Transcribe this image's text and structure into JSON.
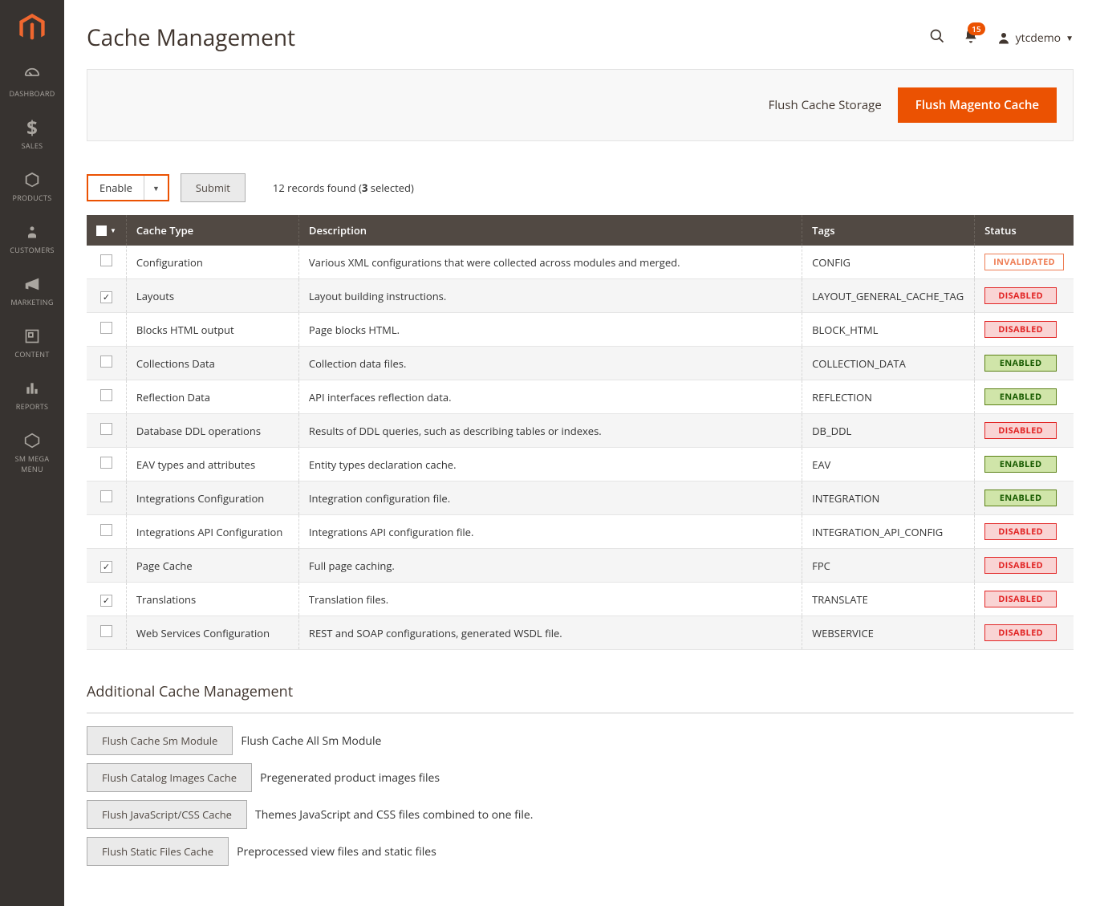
{
  "page_title": "Cache Management",
  "user": {
    "name": "ytcdemo",
    "notifications": "15"
  },
  "sidebar": [
    {
      "key": "dashboard",
      "label": "DASHBOARD"
    },
    {
      "key": "sales",
      "label": "SALES"
    },
    {
      "key": "products",
      "label": "PRODUCTS"
    },
    {
      "key": "customers",
      "label": "CUSTOMERS"
    },
    {
      "key": "marketing",
      "label": "MARKETING"
    },
    {
      "key": "content",
      "label": "CONTENT"
    },
    {
      "key": "reports",
      "label": "REPORTS"
    },
    {
      "key": "smmegamenu",
      "label": "SM MEGA\nMENU"
    }
  ],
  "titlebar": {
    "storage_link": "Flush Cache Storage",
    "flush_btn": "Flush Magento Cache"
  },
  "toolbar": {
    "action": "Enable",
    "submit": "Submit",
    "records_prefix": "12 records found (",
    "records_count": "3",
    "records_suffix": " selected)"
  },
  "headers": {
    "type": "Cache Type",
    "desc": "Description",
    "tags": "Tags",
    "status": "Status"
  },
  "rows": [
    {
      "checked": false,
      "type": "Configuration",
      "desc": "Various XML configurations that were collected across modules and merged.",
      "tags": "CONFIG",
      "status": "INVALIDATED"
    },
    {
      "checked": true,
      "type": "Layouts",
      "desc": "Layout building instructions.",
      "tags": "LAYOUT_GENERAL_CACHE_TAG",
      "status": "DISABLED"
    },
    {
      "checked": false,
      "type": "Blocks HTML output",
      "desc": "Page blocks HTML.",
      "tags": "BLOCK_HTML",
      "status": "DISABLED"
    },
    {
      "checked": false,
      "type": "Collections Data",
      "desc": "Collection data files.",
      "tags": "COLLECTION_DATA",
      "status": "ENABLED"
    },
    {
      "checked": false,
      "type": "Reflection Data",
      "desc": "API interfaces reflection data.",
      "tags": "REFLECTION",
      "status": "ENABLED"
    },
    {
      "checked": false,
      "type": "Database DDL operations",
      "desc": "Results of DDL queries, such as describing tables or indexes.",
      "tags": "DB_DDL",
      "status": "DISABLED"
    },
    {
      "checked": false,
      "type": "EAV types and attributes",
      "desc": "Entity types declaration cache.",
      "tags": "EAV",
      "status": "ENABLED"
    },
    {
      "checked": false,
      "type": "Integrations Configuration",
      "desc": "Integration configuration file.",
      "tags": "INTEGRATION",
      "status": "ENABLED"
    },
    {
      "checked": false,
      "type": "Integrations API Configuration",
      "desc": "Integrations API configuration file.",
      "tags": "INTEGRATION_API_CONFIG",
      "status": "DISABLED"
    },
    {
      "checked": true,
      "type": "Page Cache",
      "desc": "Full page caching.",
      "tags": "FPC",
      "status": "DISABLED"
    },
    {
      "checked": true,
      "type": "Translations",
      "desc": "Translation files.",
      "tags": "TRANSLATE",
      "status": "DISABLED"
    },
    {
      "checked": false,
      "type": "Web Services Configuration",
      "desc": "REST and SOAP configurations, generated WSDL file.",
      "tags": "WEBSERVICE",
      "status": "DISABLED"
    }
  ],
  "additional_title": "Additional Cache Management",
  "additional": [
    {
      "btn": "Flush Cache Sm Module",
      "desc": "Flush Cache All Sm Module"
    },
    {
      "btn": "Flush Catalog Images Cache",
      "desc": "Pregenerated product images files"
    },
    {
      "btn": "Flush JavaScript/CSS Cache",
      "desc": "Themes JavaScript and CSS files combined to one file."
    },
    {
      "btn": "Flush Static Files Cache",
      "desc": "Preprocessed view files and static files"
    }
  ]
}
